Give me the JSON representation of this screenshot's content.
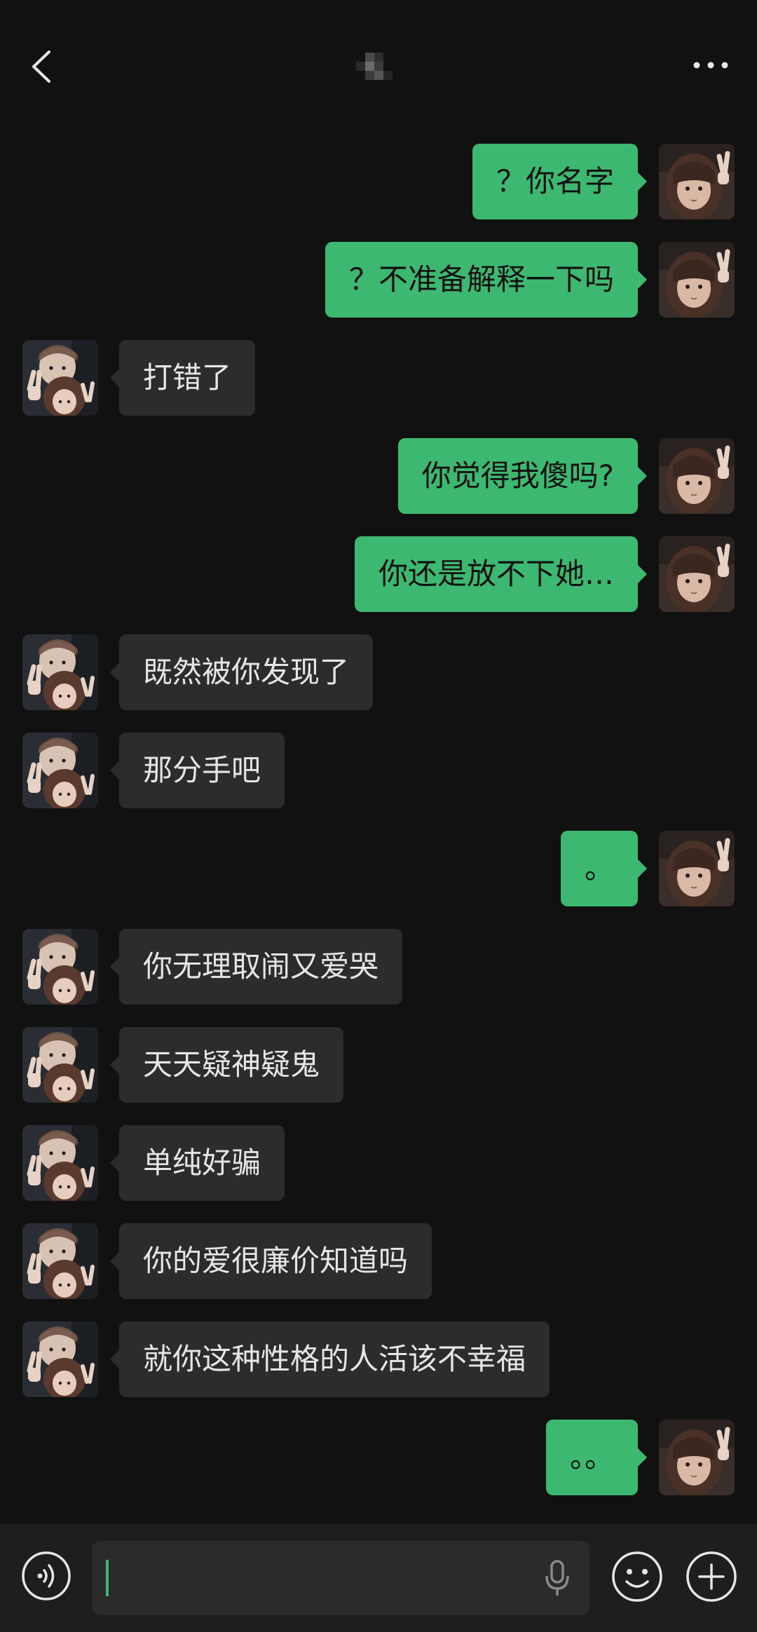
{
  "header": {
    "back_icon": "chevron-left-icon",
    "more_icon": "more-horizontal-icon"
  },
  "messages": [
    {
      "side": "out",
      "text": "？你名字"
    },
    {
      "side": "out",
      "text": "？不准备解释一下吗"
    },
    {
      "side": "in",
      "text": "打错了"
    },
    {
      "side": "out",
      "text": "你觉得我傻吗?"
    },
    {
      "side": "out",
      "text": "你还是放不下她…"
    },
    {
      "side": "in",
      "text": "既然被你发现了"
    },
    {
      "side": "in",
      "text": "那分手吧"
    },
    {
      "side": "out",
      "text": "。"
    },
    {
      "side": "in",
      "text": "你无理取闹又爱哭"
    },
    {
      "side": "in",
      "text": "天天疑神疑鬼"
    },
    {
      "side": "in",
      "text": "单纯好骗"
    },
    {
      "side": "in",
      "text": "你的爱很廉价知道吗"
    },
    {
      "side": "in",
      "text": "就你这种性格的人活该不幸福"
    },
    {
      "side": "out",
      "text": "。。"
    }
  ],
  "composer": {
    "input_value": "",
    "voice_icon": "voice-mode-icon",
    "mic_icon": "microphone-icon",
    "emoji_icon": "emoji-icon",
    "plus_icon": "plus-icon"
  },
  "colors": {
    "background": "#111111",
    "outgoing_bubble": "#3db871",
    "incoming_bubble": "#2c2c2c",
    "accent": "#3db871"
  }
}
